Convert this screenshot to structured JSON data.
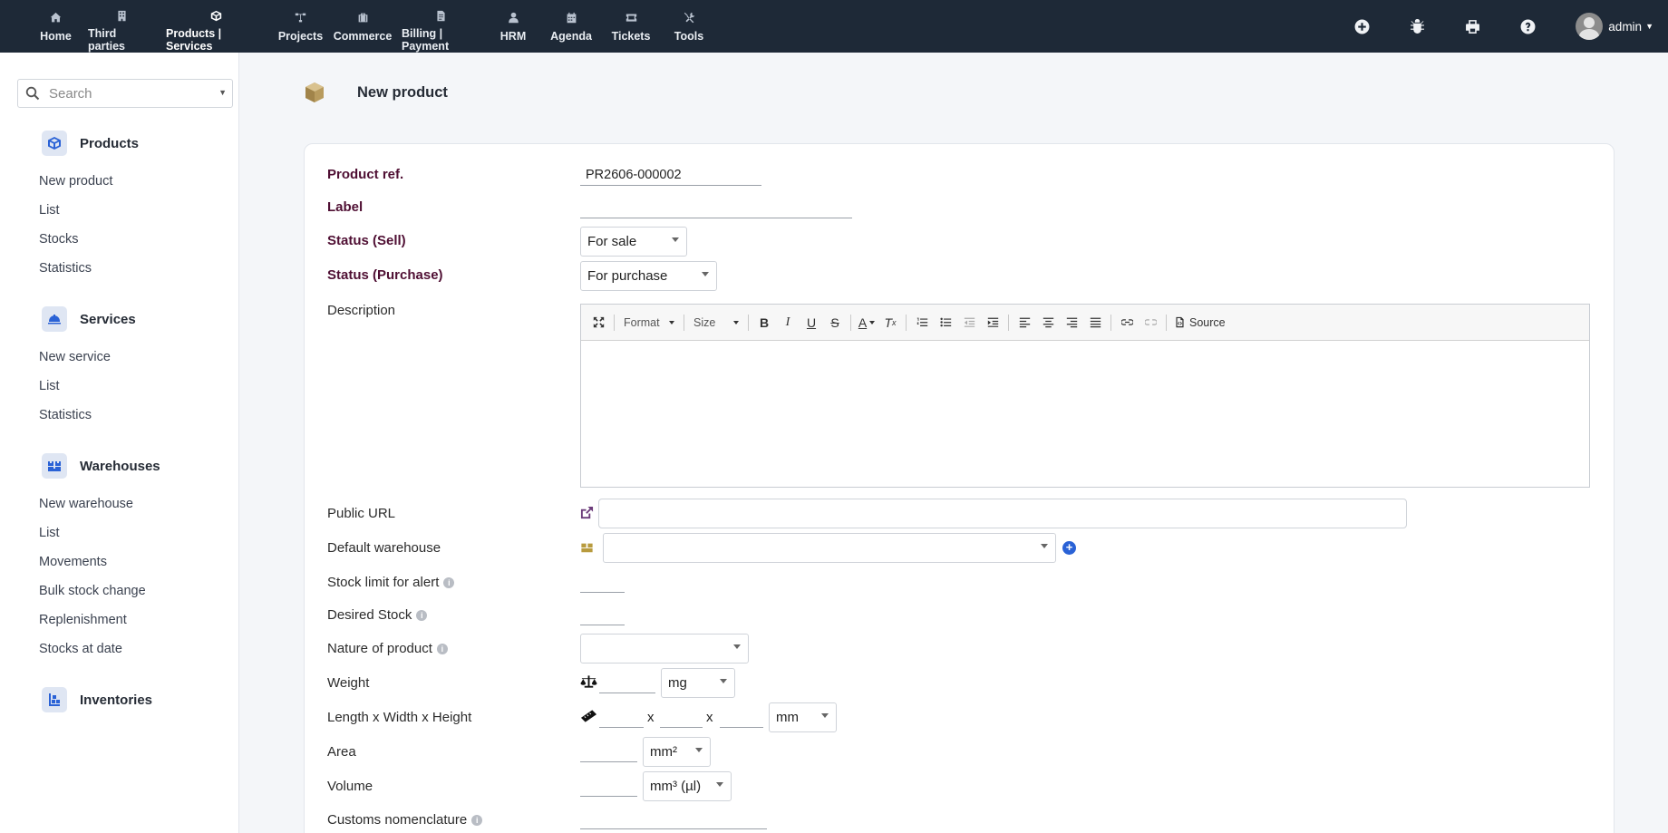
{
  "topnav": {
    "items": [
      {
        "label": "Home",
        "icon": "home-icon"
      },
      {
        "label": "Third parties",
        "icon": "building-icon"
      },
      {
        "label": "Products | Services",
        "icon": "cube-icon",
        "active": true
      },
      {
        "label": "Projects",
        "icon": "sitemap-icon"
      },
      {
        "label": "Commerce",
        "icon": "suitcase-icon"
      },
      {
        "label": "Billing | Payment",
        "icon": "invoice-icon"
      },
      {
        "label": "HRM",
        "icon": "user-tie-icon"
      },
      {
        "label": "Agenda",
        "icon": "calendar-icon"
      },
      {
        "label": "Tickets",
        "icon": "ticket-icon"
      },
      {
        "label": "Tools",
        "icon": "tools-icon"
      }
    ],
    "user": "admin"
  },
  "sidebar": {
    "search_placeholder": "Search",
    "sections": [
      {
        "title": "Products",
        "icon": "cube-icon",
        "items": [
          "New product",
          "List",
          "Stocks",
          "Statistics"
        ]
      },
      {
        "title": "Services",
        "icon": "concierge-bell-icon",
        "items": [
          "New service",
          "List",
          "Statistics"
        ]
      },
      {
        "title": "Warehouses",
        "icon": "boxes-icon",
        "items": [
          "New warehouse",
          "List",
          "Movements",
          "Bulk stock change",
          "Replenishment",
          "Stocks at date"
        ]
      },
      {
        "title": "Inventories",
        "icon": "inventory-icon",
        "items": []
      }
    ]
  },
  "page": {
    "title": "New product"
  },
  "form": {
    "product_ref": {
      "label": "Product ref.",
      "value": "PR2606-000002"
    },
    "label": {
      "label": "Label",
      "value": ""
    },
    "status_sell": {
      "label": "Status (Sell)",
      "value": "For sale"
    },
    "status_purchase": {
      "label": "Status (Purchase)",
      "value": "For purchase"
    },
    "description": {
      "label": "Description"
    },
    "editor": {
      "format": "Format",
      "size": "Size",
      "source": "Source"
    },
    "public_url": {
      "label": "Public URL",
      "value": ""
    },
    "default_warehouse": {
      "label": "Default warehouse",
      "value": ""
    },
    "stock_limit": {
      "label": "Stock limit for alert",
      "value": ""
    },
    "desired_stock": {
      "label": "Desired Stock",
      "value": ""
    },
    "nature": {
      "label": "Nature of product",
      "value": ""
    },
    "weight": {
      "label": "Weight",
      "unit": "mg"
    },
    "dimensions": {
      "label": "Length x Width x Height",
      "separator": "x",
      "unit": "mm"
    },
    "area": {
      "label": "Area",
      "unit": "mm²"
    },
    "volume": {
      "label": "Volume",
      "unit": "mm³ (µl)"
    },
    "customs": {
      "label": "Customs nomenclature",
      "value": ""
    }
  },
  "colors": {
    "topbar": "#1e2937",
    "required_label": "#4f0f33",
    "accent": "#2a62d6"
  }
}
